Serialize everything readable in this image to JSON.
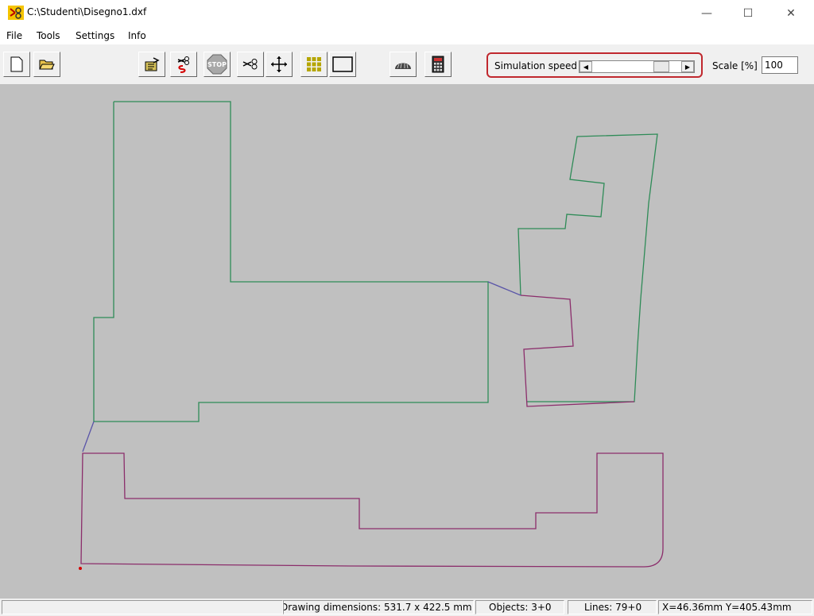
{
  "window": {
    "title": "C:\\Studenti\\Disegno1.dxf",
    "minimize_glyph": "—",
    "maximize_glyph": "☐",
    "close_glyph": "✕"
  },
  "menu": {
    "items": [
      "File",
      "Tools",
      "Settings",
      "Info"
    ]
  },
  "toolbar": {
    "buttons": [
      {
        "icon": "new-document-icon"
      },
      {
        "icon": "open-folder-icon"
      },
      {
        "icon": "export-icon"
      },
      {
        "icon": "cut-path-icon"
      },
      {
        "icon": "stop-icon",
        "label": "STOP"
      },
      {
        "icon": "scissors-icon"
      },
      {
        "icon": "move-arrows-icon"
      },
      {
        "icon": "grid-icon"
      },
      {
        "icon": "frame-icon"
      },
      {
        "icon": "machine-icon"
      },
      {
        "icon": "calculator-icon"
      }
    ],
    "simulation_speed_label": "Simulation speed",
    "simulation_speed_level": 0.84,
    "scale_label": "Scale [%]",
    "scale_value": "100"
  },
  "status": {
    "drawing_dimensions": "Drawing dimensions: 531.7 x 422.5 mm",
    "objects": "Objects: 3+0",
    "lines": "Lines: 79+0",
    "coordinates": "X=46.36mm Y=405.43mm"
  },
  "colors": {
    "canvas": "#c0c0c0",
    "green_path": "#2e8b57",
    "purple_path": "#8b2d6b",
    "blue_connector": "#5a55a8",
    "highlight": "#c0282e"
  }
}
